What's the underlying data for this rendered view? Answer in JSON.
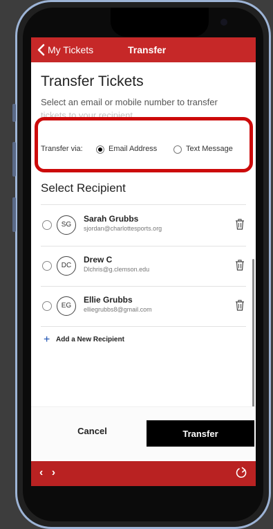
{
  "header": {
    "back_label": "My Tickets",
    "title": "Transfer"
  },
  "page": {
    "heading": "Transfer Tickets",
    "subtitle_line1": "Select an email or mobile number to transfer",
    "subtitle_line2": "tickets to your recipient"
  },
  "transfer_via": {
    "label": "Transfer via:",
    "options": [
      {
        "label": "Email Address",
        "selected": true
      },
      {
        "label": "Text Message",
        "selected": false
      }
    ]
  },
  "recipients_section": {
    "heading": "Select Recipient",
    "items": [
      {
        "initials": "SG",
        "name": "Sarah Grubbs",
        "email": "sjordan@charlottesports.org"
      },
      {
        "initials": "DC",
        "name": "Drew C",
        "email": "Dlchris@g.clemson.edu"
      },
      {
        "initials": "EG",
        "name": "Ellie Grubbs",
        "email": "elliegrubbs8@gmail.com"
      }
    ],
    "add_label": "Add a New Recipient"
  },
  "actions": {
    "cancel_label": "Cancel",
    "transfer_label": "Transfer"
  },
  "footer": {
    "nav_arrows": "‹ ›"
  },
  "colors": {
    "brand_red": "#c62828",
    "highlight_red": "#cc0a0a",
    "link_blue": "#1a4fb0"
  }
}
